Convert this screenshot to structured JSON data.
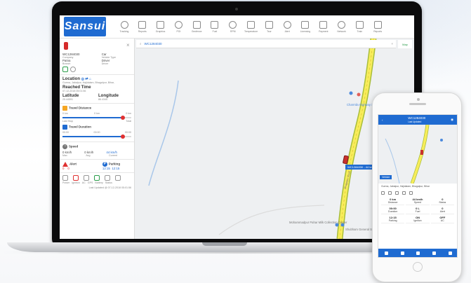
{
  "app": {
    "logo_text": "Sansui"
  },
  "nav": {
    "items": [
      {
        "label": "Tracking",
        "icon": "location-icon"
      },
      {
        "label": "Reports",
        "icon": "report-icon"
      },
      {
        "label": "Graphics",
        "icon": "chart-icon"
      },
      {
        "label": "POI",
        "icon": "poi-icon"
      },
      {
        "label": "Geofence",
        "icon": "geofence-icon"
      },
      {
        "label": "Fuel",
        "icon": "fuel-icon"
      },
      {
        "label": "RPM",
        "icon": "rpm-icon"
      },
      {
        "label": "Temperature",
        "icon": "temperature-icon"
      },
      {
        "label": "Tour",
        "icon": "tour-icon"
      },
      {
        "label": "Alert",
        "icon": "alert-icon"
      },
      {
        "label": "Licensing",
        "icon": "licensing-icon"
      },
      {
        "label": "Payment",
        "icon": "payment-icon"
      },
      {
        "label": "Network",
        "icon": "network-icon"
      },
      {
        "label": "Train",
        "icon": "train-icon"
      },
      {
        "label": "Reports",
        "icon": "notes-icon"
      }
    ]
  },
  "sidebar": {
    "vehicle_id": "WC1284030",
    "vehicle_type_label": "Car",
    "company_label": "Company",
    "vehicle_type_caption": "Vehicle Type",
    "company_value": "Patna",
    "driver_label": "Driver",
    "branch_label": "Branch",
    "driver_value": "Driver",
    "location_header": "Location",
    "location_text": "Gurma, Jabalpur, Hajidalam, Bhagalpur, Bihar,",
    "reached_header": "Reached Time",
    "reached_value": "07-12-2018 05:01:56",
    "latitude_label": "Latitude",
    "longitude_label": "Longitude",
    "latitude_value": "25.44591",
    "longitude_value": "86.4345",
    "travel_distance_label": "Travel Distance",
    "distance_start": "0 km",
    "distance_mid": "0 km",
    "distance_end": "0 km",
    "distance_left_caption": "Last Stop",
    "distance_right_caption": "Total",
    "distance_progress": 0.88,
    "travel_duration_label": "Travel Duration",
    "duration_start": "00:00",
    "duration_mid": "00:00",
    "duration_end": "00:00",
    "duration_progress": 0.88,
    "speed_label": "Speed",
    "speed_values": [
      "0 km/h",
      "0 km/h",
      "44 km/h"
    ],
    "speed_captions": [
      "Max",
      "Avg",
      "Current"
    ],
    "alert_label": "Alert",
    "parking_label": "Parking",
    "alert_values": [
      "0",
      "0"
    ],
    "parking_values": [
      "12:15",
      "12:15"
    ],
    "bottom_labels": [
      "Power",
      "Ignition",
      "AC",
      "GPS",
      "Battery",
      "Status"
    ],
    "last_updated": "Last Updated @ 07-12-2018 05:01:56"
  },
  "map": {
    "search_text": "WC1284030",
    "map_button": "Map",
    "road_label": "Bhagalpur Road",
    "vehicle_label": "WC1284030 - 44 km/h",
    "poi": [
      "Charmila Highway Services",
      "Mohammadpur Pahar Milk Collection Center",
      "Shubham General Store"
    ]
  },
  "phone": {
    "title": "WC1284030",
    "subtitle": "Last Updated",
    "vehicle_label": "Vehicle",
    "info": "Gurma, Jabalpur, Hajidalam, Bhagalpur, Bihar",
    "grid": [
      {
        "label": "Distance",
        "value": "0 km"
      },
      {
        "label": "Speed",
        "value": "44 km/h"
      },
      {
        "label": "Status",
        "value": "0"
      },
      {
        "label": "Duration",
        "value": "00:00"
      },
      {
        "label": "Fuel",
        "value": "0 L"
      },
      {
        "label": "Alert",
        "value": "0"
      },
      {
        "label": "Parking",
        "value": "12:15"
      },
      {
        "label": "Ignition",
        "value": "ON"
      },
      {
        "label": "AC",
        "value": "OFF"
      }
    ]
  }
}
